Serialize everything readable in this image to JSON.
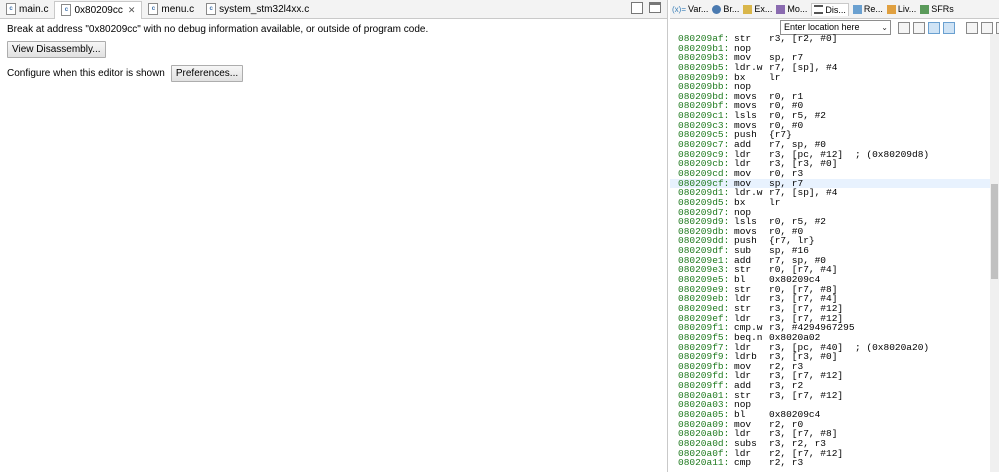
{
  "editor_tabs": [
    {
      "label": "main.c",
      "active": false,
      "icon": "c-file-icon"
    },
    {
      "label": "0x80209cc",
      "active": true,
      "icon": "c-file-icon",
      "closable": true
    },
    {
      "label": "menu.c",
      "active": false,
      "icon": "c-file-icon"
    },
    {
      "label": "system_stm32l4xx.c",
      "active": false,
      "icon": "c-file-icon"
    }
  ],
  "editor": {
    "message": "Break at address \"0x80209cc\" with no debug information available, or outside of program code.",
    "view_disassembly_label": "View Disassembly...",
    "configure_label": "Configure when this editor is shown",
    "preferences_label": "Preferences..."
  },
  "view_tabs": [
    {
      "label": "Var...",
      "icon": "variables-icon"
    },
    {
      "label": "Br...",
      "icon": "breakpoints-icon"
    },
    {
      "label": "Ex...",
      "icon": "expressions-icon"
    },
    {
      "label": "Mo...",
      "icon": "modules-icon"
    },
    {
      "label": "Dis...",
      "icon": "disassembly-icon",
      "active": true
    },
    {
      "label": "Re...",
      "icon": "registers-icon"
    },
    {
      "label": "Liv...",
      "icon": "live-expressions-icon"
    },
    {
      "label": "SFRs",
      "icon": "sfrs-icon"
    }
  ],
  "disassembly": {
    "location_placeholder": "Enter location here",
    "selected_index": 15,
    "lines": [
      {
        "addr": "080209af:",
        "op": "str",
        "arg": "r3, [r2, #0]",
        "cmt": ""
      },
      {
        "addr": "080209b1:",
        "op": "nop",
        "arg": "",
        "cmt": ""
      },
      {
        "addr": "080209b3:",
        "op": "mov",
        "arg": "sp, r7",
        "cmt": ""
      },
      {
        "addr": "080209b5:",
        "op": "ldr.w",
        "arg": "r7, [sp], #4",
        "cmt": ""
      },
      {
        "addr": "080209b9:",
        "op": "bx",
        "arg": "lr",
        "cmt": ""
      },
      {
        "addr": "080209bb:",
        "op": "nop",
        "arg": "",
        "cmt": ""
      },
      {
        "addr": "080209bd:",
        "op": "movs",
        "arg": "r0, r1",
        "cmt": ""
      },
      {
        "addr": "080209bf:",
        "op": "movs",
        "arg": "r0, #0",
        "cmt": ""
      },
      {
        "addr": "080209c1:",
        "op": "lsls",
        "arg": "r0, r5, #2",
        "cmt": ""
      },
      {
        "addr": "080209c3:",
        "op": "movs",
        "arg": "r0, #0",
        "cmt": ""
      },
      {
        "addr": "080209c5:",
        "op": "push",
        "arg": "{r7}",
        "cmt": ""
      },
      {
        "addr": "080209c7:",
        "op": "add",
        "arg": "r7, sp, #0",
        "cmt": ""
      },
      {
        "addr": "080209c9:",
        "op": "ldr",
        "arg": "r3, [pc, #12]",
        "cmt": "; (0x80209d8)"
      },
      {
        "addr": "080209cb:",
        "op": "ldr",
        "arg": "r3, [r3, #0]",
        "cmt": ""
      },
      {
        "addr": "080209cd:",
        "op": "mov",
        "arg": "r0, r3",
        "cmt": ""
      },
      {
        "addr": "080209cf:",
        "op": "mov",
        "arg": "sp, r7",
        "cmt": ""
      },
      {
        "addr": "080209d1:",
        "op": "ldr.w",
        "arg": "r7, [sp], #4",
        "cmt": ""
      },
      {
        "addr": "080209d5:",
        "op": "bx",
        "arg": "lr",
        "cmt": ""
      },
      {
        "addr": "080209d7:",
        "op": "nop",
        "arg": "",
        "cmt": ""
      },
      {
        "addr": "080209d9:",
        "op": "lsls",
        "arg": "r0, r5, #2",
        "cmt": ""
      },
      {
        "addr": "080209db:",
        "op": "movs",
        "arg": "r0, #0",
        "cmt": ""
      },
      {
        "addr": "080209dd:",
        "op": "push",
        "arg": "{r7, lr}",
        "cmt": ""
      },
      {
        "addr": "080209df:",
        "op": "sub",
        "arg": "sp, #16",
        "cmt": ""
      },
      {
        "addr": "080209e1:",
        "op": "add",
        "arg": "r7, sp, #0",
        "cmt": ""
      },
      {
        "addr": "080209e3:",
        "op": "str",
        "arg": "r0, [r7, #4]",
        "cmt": ""
      },
      {
        "addr": "080209e5:",
        "op": "bl",
        "arg": "0x80209c4",
        "cmt": ""
      },
      {
        "addr": "080209e9:",
        "op": "str",
        "arg": "r0, [r7, #8]",
        "cmt": ""
      },
      {
        "addr": "080209eb:",
        "op": "ldr",
        "arg": "r3, [r7, #4]",
        "cmt": ""
      },
      {
        "addr": "080209ed:",
        "op": "str",
        "arg": "r3, [r7, #12]",
        "cmt": ""
      },
      {
        "addr": "080209ef:",
        "op": "ldr",
        "arg": "r3, [r7, #12]",
        "cmt": ""
      },
      {
        "addr": "080209f1:",
        "op": "cmp.w",
        "arg": "r3, #4294967295",
        "cmt": ""
      },
      {
        "addr": "080209f5:",
        "op": "beq.n",
        "arg": "0x8020a02",
        "cmt": ""
      },
      {
        "addr": "080209f7:",
        "op": "ldr",
        "arg": "r3, [pc, #40]",
        "cmt": "; (0x8020a20)"
      },
      {
        "addr": "080209f9:",
        "op": "ldrb",
        "arg": "r3, [r3, #0]",
        "cmt": ""
      },
      {
        "addr": "080209fb:",
        "op": "mov",
        "arg": "r2, r3",
        "cmt": ""
      },
      {
        "addr": "080209fd:",
        "op": "ldr",
        "arg": "r3, [r7, #12]",
        "cmt": ""
      },
      {
        "addr": "080209ff:",
        "op": "add",
        "arg": "r3, r2",
        "cmt": ""
      },
      {
        "addr": "08020a01:",
        "op": "str",
        "arg": "r3, [r7, #12]",
        "cmt": ""
      },
      {
        "addr": "08020a03:",
        "op": "nop",
        "arg": "",
        "cmt": ""
      },
      {
        "addr": "08020a05:",
        "op": "bl",
        "arg": "0x80209c4",
        "cmt": ""
      },
      {
        "addr": "08020a09:",
        "op": "mov",
        "arg": "r2, r0",
        "cmt": ""
      },
      {
        "addr": "08020a0b:",
        "op": "ldr",
        "arg": "r3, [r7, #8]",
        "cmt": ""
      },
      {
        "addr": "08020a0d:",
        "op": "subs",
        "arg": "r3, r2, r3",
        "cmt": ""
      },
      {
        "addr": "08020a0f:",
        "op": "ldr",
        "arg": "r2, [r7, #12]",
        "cmt": ""
      },
      {
        "addr": "08020a11:",
        "op": "cmp",
        "arg": "r2, r3",
        "cmt": ""
      }
    ]
  }
}
